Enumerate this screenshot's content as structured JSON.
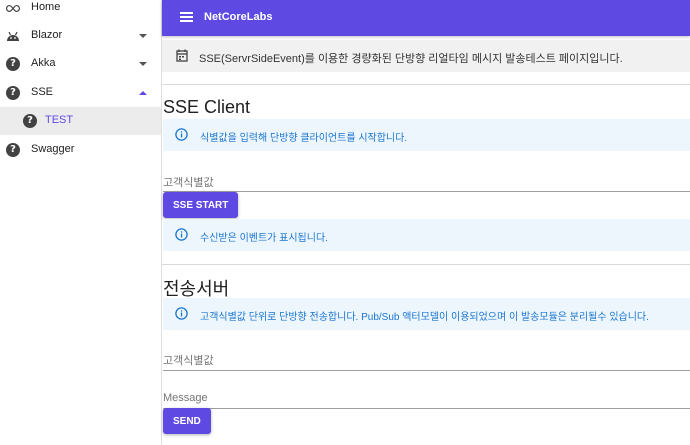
{
  "sidebar": {
    "items": [
      {
        "label": "Home",
        "icon": "infinity-icon"
      },
      {
        "label": "Blazor",
        "icon": "android-icon"
      },
      {
        "label": "Akka",
        "icon": "help-icon"
      },
      {
        "label": "SSE",
        "icon": "help-icon"
      },
      {
        "label": "TEST",
        "icon": "help-icon"
      },
      {
        "label": "Swagger",
        "icon": "help-icon"
      }
    ]
  },
  "header": {
    "title": "NetCoreLabs"
  },
  "banner": {
    "text": "SSE(ServrSideEvent)를 이용한 경량화된 단방향 리얼타임 메시지 발송테스트 페이지입니다."
  },
  "client": {
    "title": "SSE Client",
    "info": "식별값을 입력해 단방향 클라이언트를 시작합니다.",
    "id_label": "고객식별값",
    "id_value": "",
    "start_button": "SSE START",
    "events_info": "수신받은 이벤트가 표시됩니다."
  },
  "server": {
    "title": "전송서버",
    "info": "고객식별값 단위로 단방향 전송합니다. Pub/Sub 액터모델이 이용되었으며 이 발송모듈은 분리될수 있습니다.",
    "id_label": "고객식별값",
    "id_value": "",
    "message_label": "Message",
    "message_value": "",
    "send_button": "SEND"
  },
  "colors": {
    "primary": "#5e4ae3",
    "info_bg": "#eef6fd",
    "info_text": "#1976d2"
  }
}
